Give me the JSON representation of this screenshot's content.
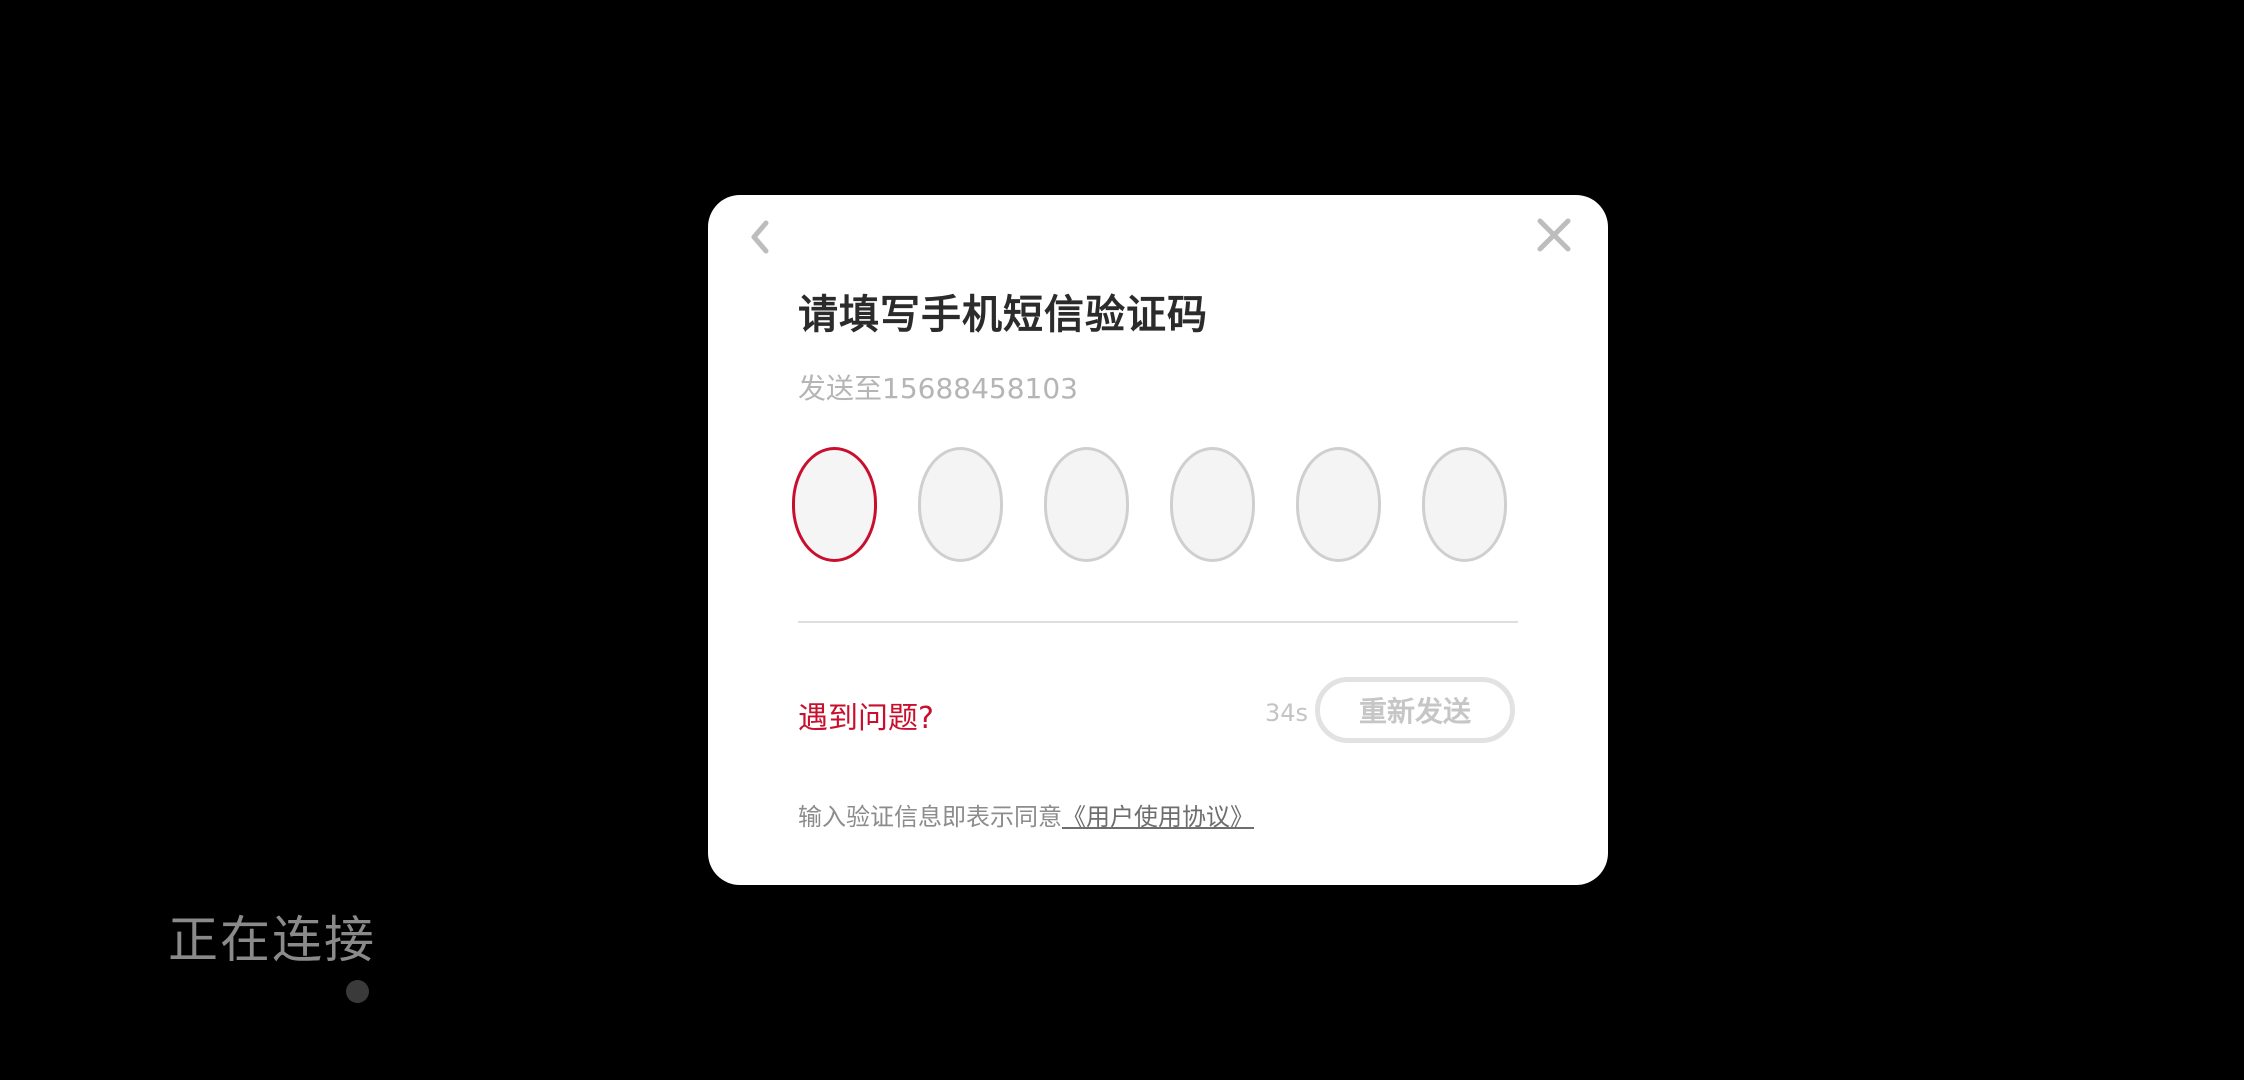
{
  "status": {
    "connecting_text": "正在连接"
  },
  "dialog": {
    "title": "请填写手机短信验证码",
    "subtitle": "发送至15688458103",
    "code_boxes": [
      "",
      "",
      "",
      "",
      "",
      ""
    ],
    "help_link": "遇到问题?",
    "countdown": "34s",
    "resend_label": "重新发送",
    "agreement_prefix": "输入验证信息即表示同意",
    "agreement_link": "《用户使用协议》",
    "icons": {
      "back": "chevron-left-icon",
      "close": "close-icon"
    },
    "colors": {
      "accent": "#c8102e",
      "muted": "#b5b5b5",
      "box_border": "#cfcfcf",
      "box_fill": "#f4f4f4"
    }
  }
}
